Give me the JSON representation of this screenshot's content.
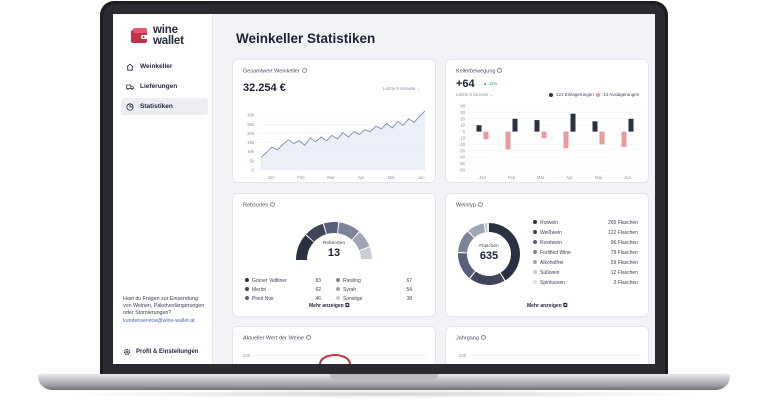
{
  "logo": {
    "line1": "wine",
    "line2": "wallet",
    "brand_color": "#c23045"
  },
  "sidebar": {
    "items": [
      {
        "label": "Weinkeller",
        "icon": "home-icon",
        "active": false
      },
      {
        "label": "Lieferungen",
        "icon": "truck-icon",
        "active": false
      },
      {
        "label": "Statistiken",
        "icon": "pie-chart-icon",
        "active": true
      }
    ],
    "help_text": "Hast du Fragen zur Einsendung von Weinen, Paketverlängerungen oder Stornierungen?",
    "help_email": "kundenservice@wine-wallet.at",
    "profile_label": "Profil & Einstellungen"
  },
  "page_title": "Weinkeller Statistiken",
  "total_value": {
    "title": "Gesamtwert Weinkeller",
    "value": "32.254 €",
    "range": "Letzte 6 Monate",
    "chart_data": {
      "type": "line",
      "x_ticks": [
        "Jan",
        "Feb",
        "Mar",
        "Apr",
        "Mai",
        "Jun"
      ],
      "y_ticks": [
        "0",
        "5k",
        "10k",
        "15k",
        "20k",
        "25k",
        "30k"
      ],
      "ylim": [
        0,
        35000
      ],
      "values": [
        7000,
        9500,
        12500,
        11000,
        14000,
        16500,
        14500,
        16000,
        13500,
        17500,
        15500,
        18000,
        16000,
        19000,
        17000,
        20500,
        18000,
        21000,
        19500,
        22000,
        21000,
        24000,
        22500,
        25500,
        23000,
        26500,
        24500,
        28000,
        26000,
        29500,
        32254
      ]
    }
  },
  "movement": {
    "title": "Kellerbewegung",
    "value": "+64",
    "change": "11%",
    "range": "Letzte 6 Monate",
    "legend_in": "121 Einlagerungen",
    "legend_out": "13 Auslagerungen",
    "colors": {
      "in": "#2b3040",
      "out": "#e79aa0"
    },
    "chart_data": {
      "type": "bar",
      "categories": [
        "Jan",
        "Feb",
        "Mar",
        "Apr",
        "Mai",
        "Jun"
      ],
      "y_ticks": [
        "40",
        "30",
        "20",
        "10",
        "0",
        "-10",
        "-20",
        "-30",
        "-40",
        "-50",
        "-60"
      ],
      "ylim": [
        -60,
        40
      ],
      "series": [
        {
          "name": "Einlagerungen",
          "values": [
            10,
            20,
            18,
            28,
            16,
            20
          ]
        },
        {
          "name": "Auslagerungen",
          "values": [
            -12,
            -28,
            -10,
            -26,
            -20,
            -24
          ]
        }
      ]
    }
  },
  "rebsorten": {
    "title": "Rebsorten",
    "center_label": "Rebsorten",
    "center_value": "13",
    "segments": [
      {
        "label": "Grüner Veltliner",
        "value": "83",
        "color": "#2b3040"
      },
      {
        "label": "Merlot",
        "value": "62",
        "color": "#404658"
      },
      {
        "label": "Pinot Noir",
        "value": "46",
        "color": "#59607a"
      },
      {
        "label": "Riesling",
        "value": "67",
        "color": "#7d8398"
      },
      {
        "label": "Syrah",
        "value": "54",
        "color": "#a0a5b4"
      },
      {
        "label": "Sonstige",
        "value": "38",
        "color": "#c9ccd5"
      }
    ],
    "more": "Mehr anzeigen"
  },
  "weintyp": {
    "title": "Weintyp",
    "center_label": "Flaschen",
    "center_value": "635",
    "rows": [
      {
        "label": "Rotwein",
        "value": "265 Flaschen",
        "color": "#2b3040"
      },
      {
        "label": "Weißwein",
        "value": "122 Flaschen",
        "color": "#404658"
      },
      {
        "label": "Roséwein",
        "value": "96 Flaschen",
        "color": "#59607a"
      },
      {
        "label": "Fortified Wine",
        "value": "79 Flaschen",
        "color": "#7d8398"
      },
      {
        "label": "Alkoholfrei",
        "value": "59 Flaschen",
        "color": "#a0a5b4"
      },
      {
        "label": "Süßwein",
        "value": "12 Flaschen",
        "color": "#c2c6d0"
      },
      {
        "label": "Spirituosen",
        "value": "2 Flaschen",
        "color": "#dcdfe6"
      }
    ],
    "more": "Mehr anzeigen"
  },
  "current_value": {
    "title": "Aktueller Wert der Weine",
    "y_top": "100"
  },
  "jahrgang": {
    "title": "Jahrgang",
    "y_top": "100"
  }
}
